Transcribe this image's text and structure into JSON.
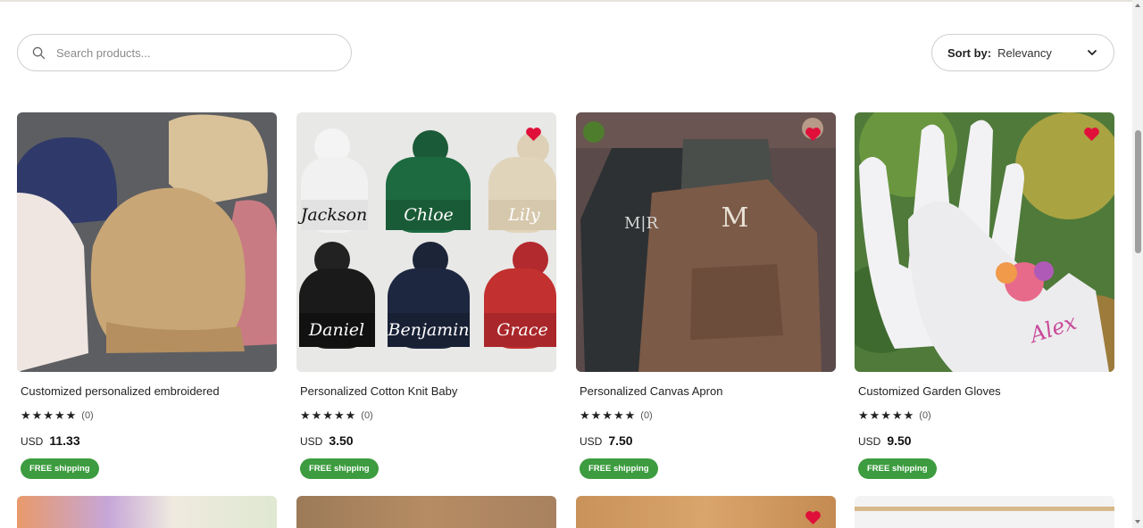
{
  "search": {
    "placeholder": "Search products..."
  },
  "sort": {
    "label": "Sort by:",
    "value": "Relevancy"
  },
  "colors": {
    "favorite": "#e0103a",
    "free_shipping_badge": "#3c9c3f"
  },
  "products": [
    {
      "title": "Customized personalized embroidered",
      "stars": "★★★★★",
      "reviews": "(0)",
      "currency": "USD",
      "price": "11.33",
      "shipping": "FREE shipping",
      "favorited": false,
      "image": "embroidered-caps"
    },
    {
      "title": "Personalized Cotton Knit Baby",
      "stars": "★★★★★",
      "reviews": "(0)",
      "currency": "USD",
      "price": "3.50",
      "shipping": "FREE shipping",
      "favorited": true,
      "image": "knit-beanies",
      "beanie_names": [
        "Jackson",
        "Chloe",
        "Lily",
        "Daniel",
        "Benjamin",
        "Grace"
      ]
    },
    {
      "title": "Personalized Canvas Apron",
      "stars": "★★★★★",
      "reviews": "(0)",
      "currency": "USD",
      "price": "7.50",
      "shipping": "FREE shipping",
      "favorited": true,
      "image": "canvas-aprons"
    },
    {
      "title": "Customized Garden Gloves",
      "stars": "★★★★★",
      "reviews": "(0)",
      "currency": "USD",
      "price": "9.50",
      "shipping": "FREE shipping",
      "favorited": true,
      "image": "garden-gloves",
      "glove_name": "Alex"
    }
  ],
  "icons": {
    "search": "search-icon",
    "sort_chevron": "chevron-down-icon",
    "favorite": "heart-icon"
  }
}
